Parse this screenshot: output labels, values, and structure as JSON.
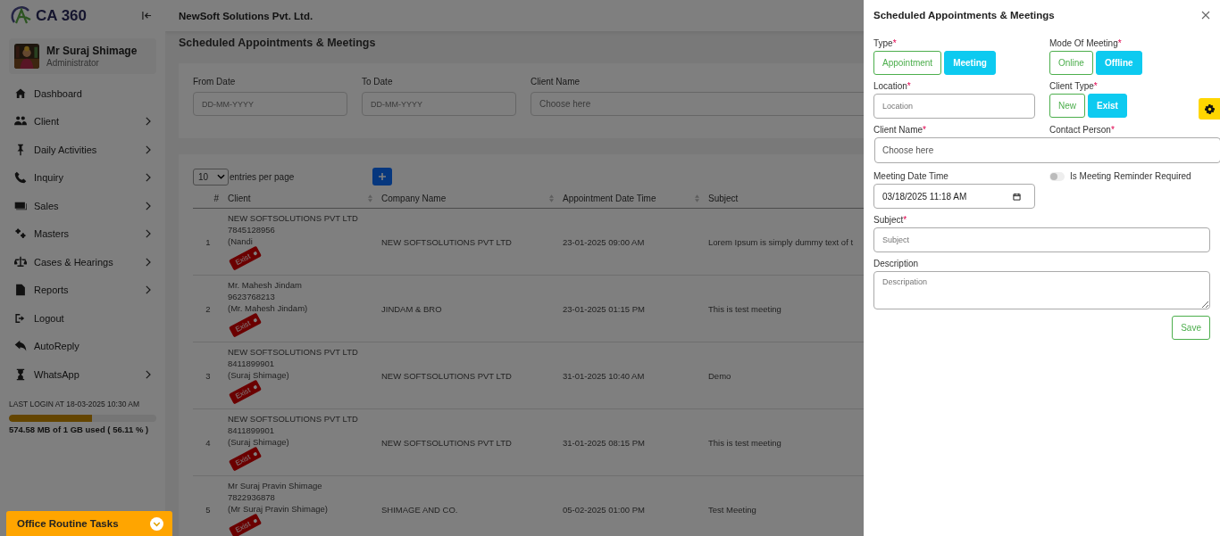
{
  "sidebar": {
    "logo": "CA 360",
    "user": {
      "name": "Mr Suraj Shimage",
      "role": "Administrator"
    },
    "items": [
      {
        "label": "Dashboard",
        "submenu": false
      },
      {
        "label": "Client",
        "submenu": true
      },
      {
        "label": "Daily Activities",
        "submenu": true
      },
      {
        "label": "Inquiry",
        "submenu": true
      },
      {
        "label": "Sales",
        "submenu": true
      },
      {
        "label": "Masters",
        "submenu": true
      },
      {
        "label": "Cases & Hearings",
        "submenu": true
      },
      {
        "label": "Reports",
        "submenu": true
      },
      {
        "label": "Logout",
        "submenu": false
      },
      {
        "label": "AutoReply",
        "submenu": false
      },
      {
        "label": "WhatsApp",
        "submenu": true
      }
    ],
    "last_login": "LAST LOGIN AT 18-03-2025 10:30 AM",
    "storage": {
      "level": 0.5611,
      "text": "574.58 MB of 1 GB used ( 56.11 % )"
    }
  },
  "header": {
    "company": "NewSoft Solutions Pvt. Ltd."
  },
  "page_title": "Scheduled Appointments & Meetings",
  "filters": [
    {
      "label": "From Date",
      "placeholder": "DD-MM-YYYY"
    },
    {
      "label": "To Date",
      "placeholder": "DD-MM-YYYY"
    },
    {
      "label": "Client Name",
      "placeholder": "Choose here"
    }
  ],
  "table": {
    "page_size": "10",
    "page_size_label": "entries per page",
    "columns": [
      {
        "label": "#",
        "sortable": false
      },
      {
        "label": "Client",
        "sortable": true
      },
      {
        "label": "Company Name",
        "sortable": true
      },
      {
        "label": "Appointment Date Time",
        "sortable": true
      },
      {
        "label": "Subject",
        "sortable": false
      }
    ],
    "rows": [
      {
        "number": "1",
        "client": [
          "NEW SOFTSOLUTIONS PVT LTD",
          "7845128956",
          "(Nandi"
        ],
        "tag": "Exist",
        "company": "NEW SOFTSOLUTIONS PVT LTD",
        "datetime": "23-01-2025 09:00 AM",
        "subject": "Lorem Ipsum is simply dummy text of t"
      },
      {
        "number": "2",
        "client": [
          "Mr. Mahesh Jindam",
          "9623768213",
          "(Mr. Mahesh Jindam)"
        ],
        "tag": "Exist",
        "company": "JINDAM & BRO",
        "datetime": "23-01-2025 01:15 PM",
        "subject": "This is test meeting"
      },
      {
        "number": "3",
        "client": [
          "NEW SOFTSOLUTIONS PVT LTD",
          "8411899901",
          "(Suraj Shimage)"
        ],
        "tag": "Exist",
        "company": "NEW SOFTSOLUTIONS PVT LTD",
        "datetime": "31-01-2025 10:40 AM",
        "subject": "Demo"
      },
      {
        "number": "4",
        "client": [
          "NEW SOFTSOLUTIONS PVT LTD",
          "8411899901",
          "(Suraj Shimage)"
        ],
        "tag": "Exist",
        "company": "NEW SOFTSOLUTIONS PVT LTD",
        "datetime": "31-01-2025 08:15 PM",
        "subject": "This is test meeting"
      },
      {
        "number": "5",
        "client": [
          "Mr Suraj Pravin Shimage",
          "7822936878",
          "(Mr Suraj Pravin Shimage)"
        ],
        "tag": "Exist",
        "company": "SHIMAGE AND CO.",
        "datetime": "05-02-2025 01:00 PM",
        "subject": "Test Meeting"
      }
    ]
  },
  "office_tasks": {
    "label": "Office Routine Tasks"
  },
  "drawer": {
    "title": "Scheduled Appointments & Meetings",
    "type": {
      "label": "Type",
      "mark": "*",
      "options": [
        {
          "label": "Appointment",
          "selected": false
        },
        {
          "label": "Meeting",
          "selected": true
        }
      ]
    },
    "mode": {
      "label": "Mode Of Meeting",
      "mark": "*",
      "options": [
        {
          "label": "Online",
          "selected": false
        },
        {
          "label": "Offline",
          "selected": true
        }
      ]
    },
    "location": {
      "label": "Location",
      "mark": "*",
      "placeholder": "Location"
    },
    "client_type": {
      "label": "Client Type",
      "mark": "*",
      "options": [
        {
          "label": "New",
          "selected": false
        },
        {
          "label": "Exist",
          "selected": true
        }
      ]
    },
    "client_name": {
      "label": "Client Name",
      "mark": "*",
      "placeholder": "Choose here"
    },
    "contact_person": {
      "label": "Contact Person",
      "mark": "*"
    },
    "meeting_datetime": {
      "label": "Meeting Date Time",
      "value": "03/18/2025 11:18  AM"
    },
    "reminder": {
      "label": "Is Meeting Reminder Required",
      "on": false
    },
    "subject": {
      "label": "Subject",
      "mark": "*",
      "placeholder": "Subject"
    },
    "description": {
      "label": "Description",
      "placeholder": "Descripation"
    },
    "save": "Save"
  }
}
